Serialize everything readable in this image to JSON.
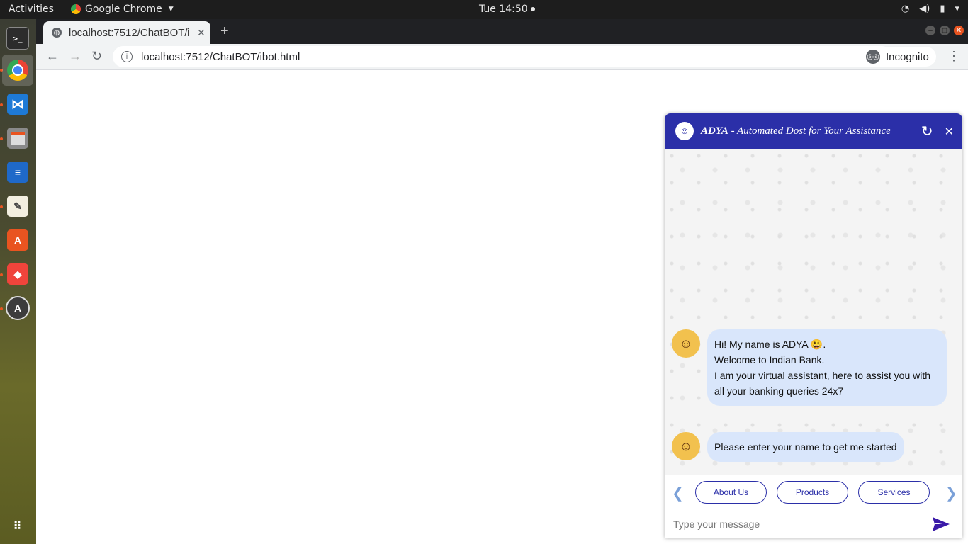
{
  "topbar": {
    "activities": "Activities",
    "app_name": "Google Chrome",
    "clock": "Tue 14:50"
  },
  "dock": {
    "items": [
      "terminal-icon",
      "chrome-icon",
      "vscode-icon",
      "files-icon",
      "writer-icon",
      "text-editor-icon",
      "software-center-icon",
      "anydesk-icon",
      "software-updater-icon",
      "app-grid-icon"
    ]
  },
  "browser": {
    "tab_title": "localhost:7512/ChatBOT/i",
    "url": "localhost:7512/ChatBOT/ibot.html",
    "incognito_label": "Incognito"
  },
  "chat": {
    "header_name": "ADYA",
    "header_subtitle": " - Automated Dost for Your Assistance",
    "messages": [
      {
        "lines": [
          "Hi! My name is ADYA 😃.",
          "Welcome to Indian Bank.",
          "I am your virtual assistant, here to assist you with all your banking queries 24x7"
        ]
      },
      {
        "lines": [
          "Please enter your name to get me started"
        ]
      }
    ],
    "quick_replies": [
      "About Us",
      "Products",
      "Services"
    ],
    "input_placeholder": "Type your message",
    "colors": {
      "header": "#2b2fa8",
      "bubble": "#d9e6fb",
      "accent": "#2b2fa8"
    }
  }
}
